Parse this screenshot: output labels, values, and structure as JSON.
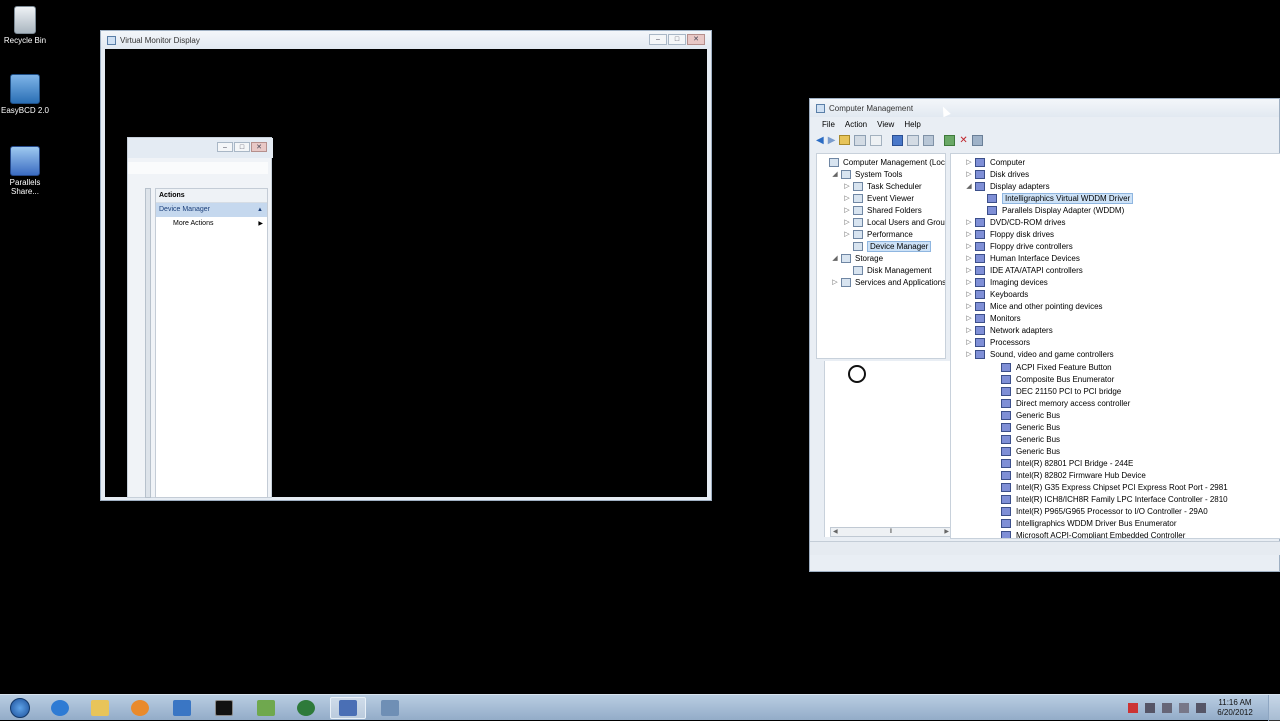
{
  "desktop": {
    "icons": [
      {
        "label": "Recycle Bin"
      },
      {
        "label": "EasyBCD 2.0"
      },
      {
        "label": "Parallels Share..."
      }
    ]
  },
  "vmd": {
    "title": "Virtual Monitor Display",
    "inner": {
      "actions_header": "Actions",
      "selected_action": "Device Manager",
      "more_actions": "More Actions"
    }
  },
  "cm": {
    "title": "Computer Management",
    "menu": [
      "File",
      "Action",
      "View",
      "Help"
    ],
    "left_tree": [
      {
        "label": "Computer Management (Local",
        "indent": 0,
        "exp": ""
      },
      {
        "label": "System Tools",
        "indent": 1,
        "exp": "◢"
      },
      {
        "label": "Task Scheduler",
        "indent": 2,
        "exp": "▷"
      },
      {
        "label": "Event Viewer",
        "indent": 2,
        "exp": "▷"
      },
      {
        "label": "Shared Folders",
        "indent": 2,
        "exp": "▷"
      },
      {
        "label": "Local Users and Groups",
        "indent": 2,
        "exp": "▷"
      },
      {
        "label": "Performance",
        "indent": 2,
        "exp": "▷"
      },
      {
        "label": "Device Manager",
        "indent": 2,
        "exp": "",
        "selected": true
      },
      {
        "label": "Storage",
        "indent": 1,
        "exp": "◢"
      },
      {
        "label": "Disk Management",
        "indent": 2,
        "exp": ""
      },
      {
        "label": "Services and Applications",
        "indent": 1,
        "exp": "▷"
      }
    ],
    "devices": [
      {
        "label": "Computer",
        "indent": 0,
        "exp": "▷"
      },
      {
        "label": "Disk drives",
        "indent": 0,
        "exp": "▷"
      },
      {
        "label": "Display adapters",
        "indent": 0,
        "exp": "◢"
      },
      {
        "label": "Intelligraphics Virtual WDDM Driver",
        "indent": 1,
        "exp": "",
        "selected": true
      },
      {
        "label": "Parallels Display Adapter (WDDM)",
        "indent": 1,
        "exp": ""
      },
      {
        "label": "DVD/CD-ROM drives",
        "indent": 0,
        "exp": "▷"
      },
      {
        "label": "Floppy disk drives",
        "indent": 0,
        "exp": "▷"
      },
      {
        "label": "Floppy drive controllers",
        "indent": 0,
        "exp": "▷"
      },
      {
        "label": "Human Interface Devices",
        "indent": 0,
        "exp": "▷"
      },
      {
        "label": "IDE ATA/ATAPI controllers",
        "indent": 0,
        "exp": "▷"
      },
      {
        "label": "Imaging devices",
        "indent": 0,
        "exp": "▷"
      },
      {
        "label": "Keyboards",
        "indent": 0,
        "exp": "▷"
      },
      {
        "label": "Mice and other pointing devices",
        "indent": 0,
        "exp": "▷"
      },
      {
        "label": "Monitors",
        "indent": 0,
        "exp": "▷"
      },
      {
        "label": "Network adapters",
        "indent": 0,
        "exp": "▷"
      },
      {
        "label": "Processors",
        "indent": 0,
        "exp": "▷"
      },
      {
        "label": "Sound, video and game controllers",
        "indent": 0,
        "exp": "▷"
      }
    ],
    "system_devices": [
      "ACPI Fixed Feature Button",
      "Composite Bus Enumerator",
      "DEC 21150 PCI to PCI bridge",
      "Direct memory access controller",
      "Generic Bus",
      "Generic Bus",
      "Generic Bus",
      "Generic Bus",
      "Intel(R) 82801 PCI Bridge - 244E",
      "Intel(R) 82802 Firmware Hub Device",
      "Intel(R) G35 Express Chipset PCI Express Root Port - 2981",
      "Intel(R) ICH8/ICH8R Family LPC Interface Controller - 2810",
      "Intel(R) P965/G965 Processor to I/O Controller - 29A0",
      "Intelligraphics WDDM Driver Bus Enumerator",
      "Microsoft ACPI-Compliant Embedded Controller"
    ]
  },
  "tray": {
    "time": "11:16 AM",
    "date": "6/20/2012"
  },
  "colors": {
    "taskbar": "#a9bfd8",
    "selection": "#cde2f7"
  }
}
